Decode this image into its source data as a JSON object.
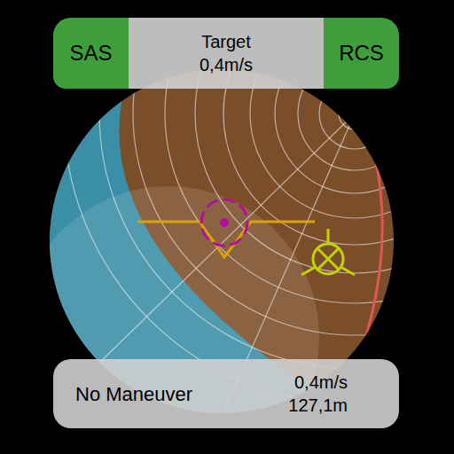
{
  "top_bar": {
    "sas": {
      "label": "SAS",
      "on": true
    },
    "speed_mode": "Target",
    "speed": "0,4m/s",
    "rcs": {
      "label": "RCS",
      "on": true
    }
  },
  "maneuver": {
    "label": "No Maneuver",
    "delta_v": "0,4m/s",
    "distance": "127,1m"
  }
}
